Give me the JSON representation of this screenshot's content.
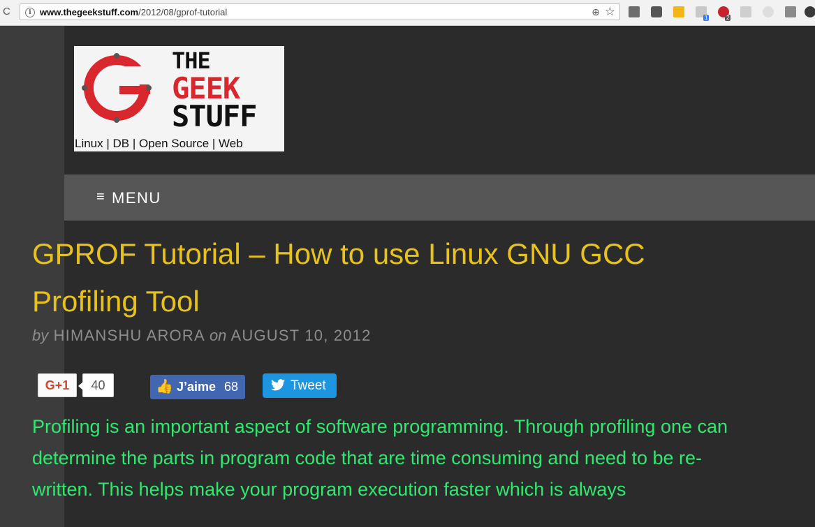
{
  "browser": {
    "url_host": "www.thegeekstuff.com",
    "url_path": "/2012/08/gprof-tutorial",
    "extension_badges": [
      "1",
      "2"
    ]
  },
  "logo": {
    "line1": "THE",
    "line2": "GEEK",
    "line3": "STUFF",
    "tagline": "Linux | DB | Open Source | Web",
    "letter": "G"
  },
  "menu": {
    "label": "MENU",
    "icon": "≡"
  },
  "article": {
    "title": "GPROF Tutorial – How to use Linux GNU GCC Profiling Tool",
    "by_word": "by",
    "author": "HIMANSHU ARORA",
    "on_word": "on",
    "date": "AUGUST 10, 2012",
    "intro": "Profiling is an important aspect of software programming. Through profiling one can determine the parts in program code that are time consuming and need to be re-written. This helps make your program execution faster which is always"
  },
  "social": {
    "gplus_label": "G+1",
    "gplus_count": "40",
    "fb_label": "J’aime",
    "fb_count": "68",
    "tweet_label": "Tweet"
  },
  "colors": {
    "title": "#e8c21c",
    "body_text": "#2ee86f",
    "page_bg": "#2b2b2b",
    "menu_bg": "#565656",
    "logo_red": "#d9272e"
  }
}
